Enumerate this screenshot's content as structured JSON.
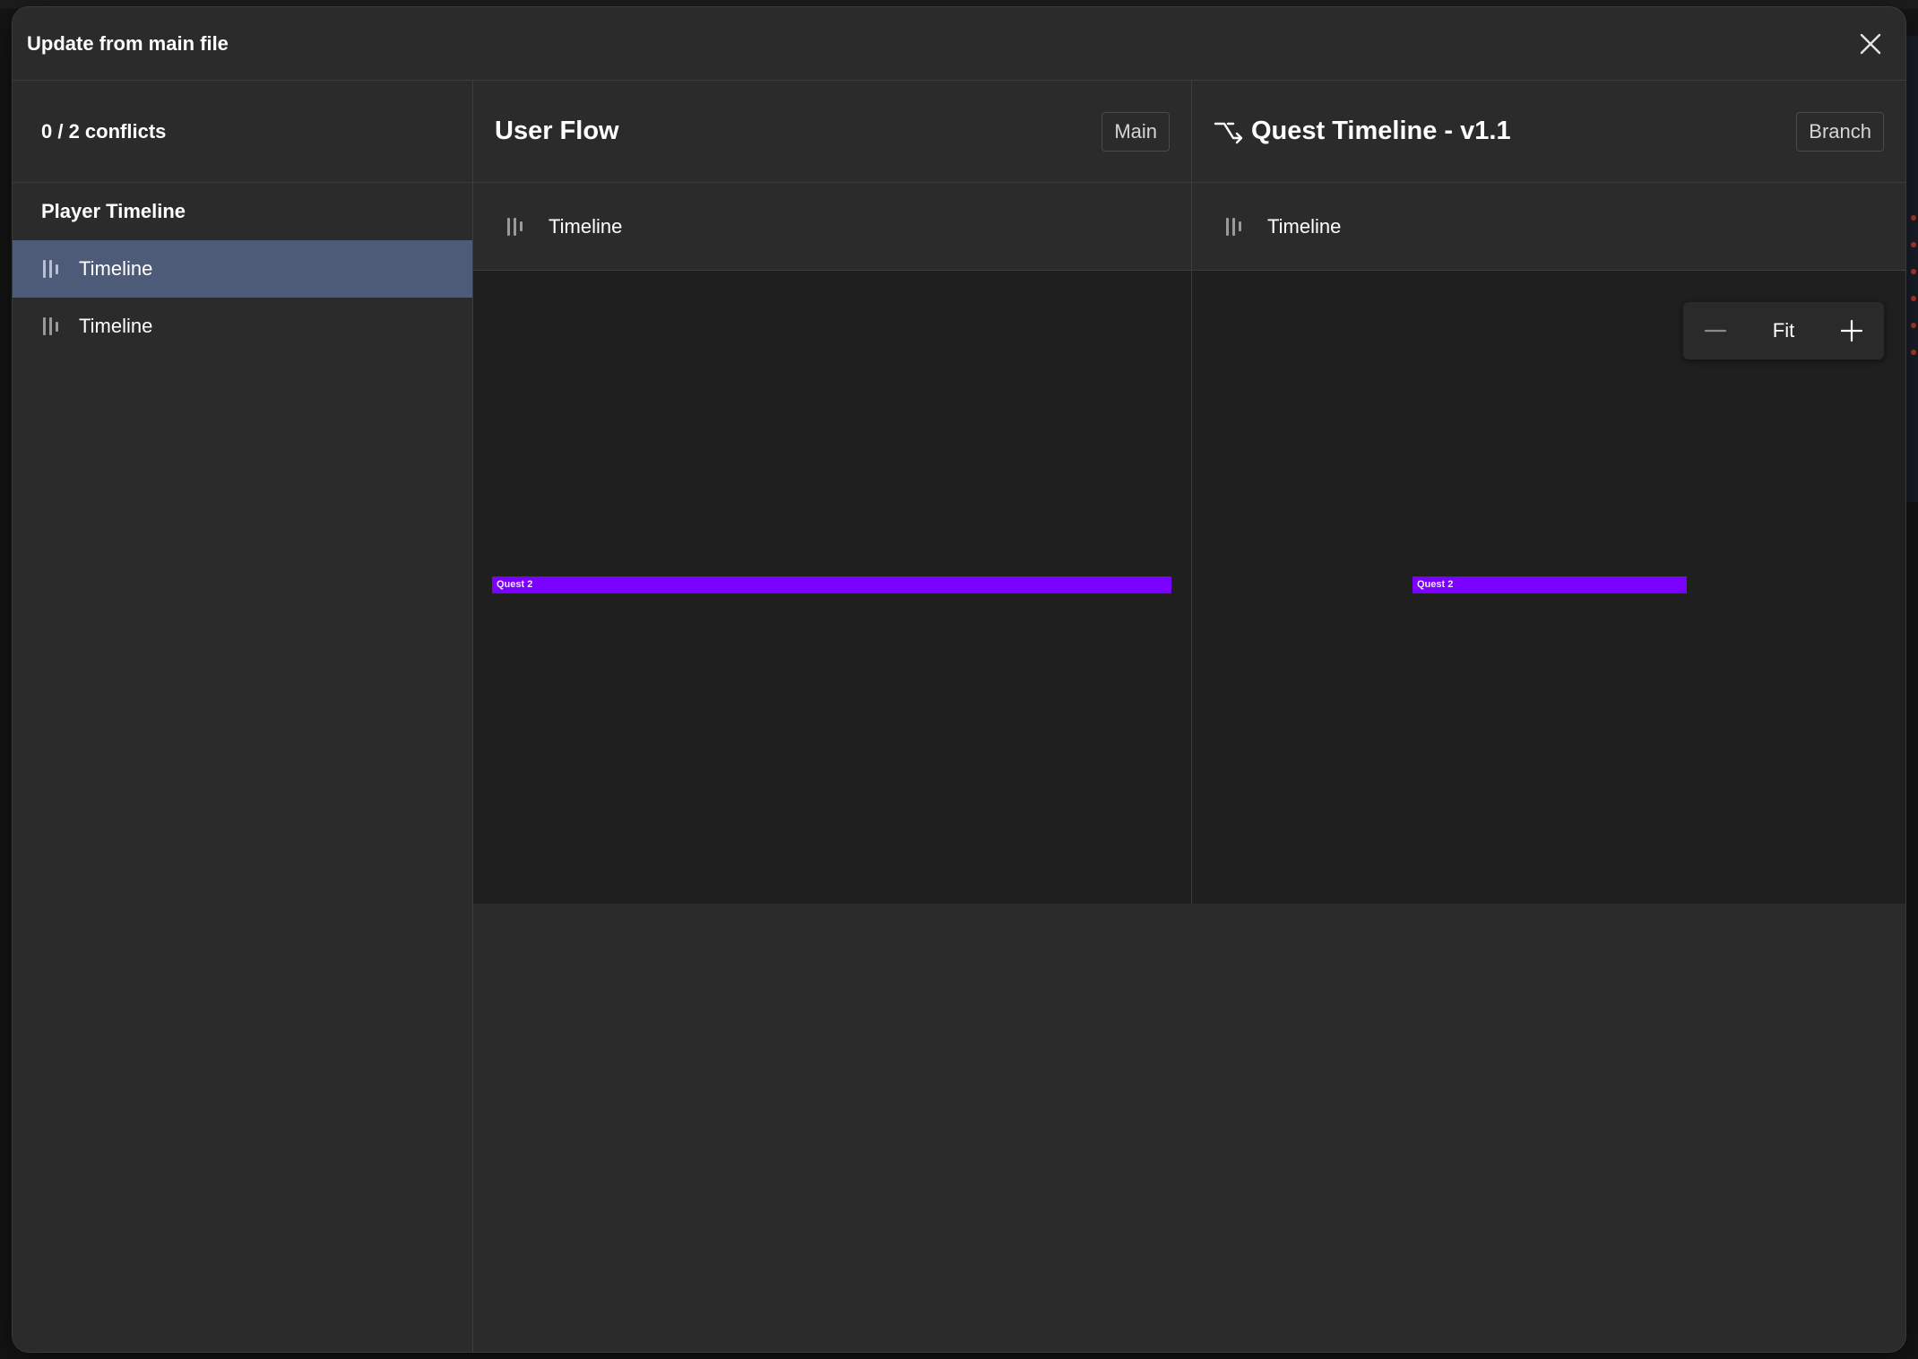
{
  "modal": {
    "title": "Update from main file",
    "close_icon": "close-icon"
  },
  "sidebar": {
    "conflicts": "0 / 2 conflicts",
    "group_title": "Player Timeline",
    "items": [
      {
        "label": "Timeline",
        "icon": "timeline-icon",
        "selected": true
      },
      {
        "label": "Timeline",
        "icon": "timeline-icon",
        "selected": false
      }
    ]
  },
  "left_pane": {
    "title": "User Flow",
    "badge": "Main",
    "layer_label": "Timeline",
    "bar_label": "Quest 2"
  },
  "right_pane": {
    "title": "Quest Timeline - v1.1",
    "title_icon": "branch-icon",
    "badge": "Branch",
    "layer_label": "Timeline",
    "bar_label": "Quest 2",
    "zoom": {
      "minus_icon": "minus-icon",
      "fit_label": "Fit",
      "plus_icon": "plus-icon"
    }
  },
  "colors": {
    "selected_row": "#4e5b78",
    "bar": "#7a00ff",
    "canvas": "#1f1f1f",
    "panel": "#2b2b2b"
  }
}
